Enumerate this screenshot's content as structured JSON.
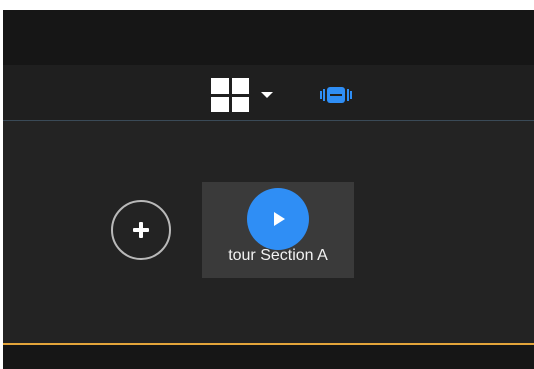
{
  "toolbar": {
    "layout_icon": "grid-layout-icon",
    "layout_dropdown_icon": "chevron-down-icon",
    "vr_icon": "vr-headset-icon",
    "accent_color": "#2f8ef5"
  },
  "stage": {
    "add_icon": "plus-icon",
    "tour": {
      "label": "tour Section A",
      "play_icon": "play-icon",
      "play_color": "#2f8ef5"
    }
  },
  "footer": {
    "accent_color": "#e3a43a"
  }
}
